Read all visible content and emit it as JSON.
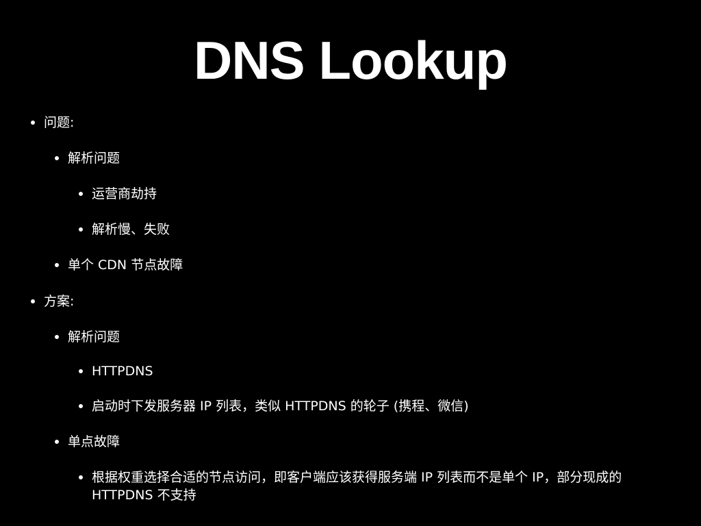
{
  "slide": {
    "title": "DNS Lookup",
    "bullets": [
      {
        "text": "问题:"
      },
      {
        "text": "解析问题"
      },
      {
        "text": "运营商劫持"
      },
      {
        "text": "解析慢、失败"
      },
      {
        "text": "单个 CDN 节点故障"
      },
      {
        "text": "方案:"
      },
      {
        "text": "解析问题"
      },
      {
        "text": "HTTPDNS"
      },
      {
        "text": "启动时下发服务器 IP 列表，类似 HTTPDNS 的轮子 (携程、微信)"
      },
      {
        "text": "单点故障"
      },
      {
        "text": "根据权重选择合适的节点访问，即客户端应该获得服务端 IP 列表而不是单个 IP，部分现成的"
      },
      {
        "text": "HTTPDNS 不支持"
      }
    ]
  },
  "colors": {
    "background": "#000000",
    "text": "#ffffff"
  }
}
